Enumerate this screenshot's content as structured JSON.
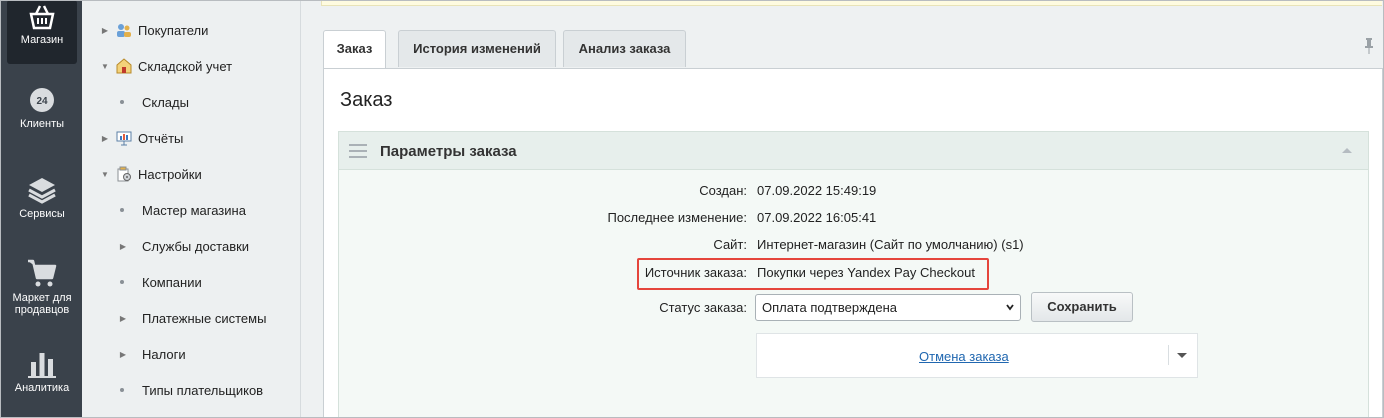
{
  "rail": {
    "items": [
      {
        "label": "Магазин",
        "icon": "basket-icon"
      },
      {
        "label": "Клиенты",
        "icon": "clock-24-icon"
      },
      {
        "label": "Сервисы",
        "icon": "layers-icon"
      },
      {
        "label": "Маркет для продавцов",
        "icon": "cart-icon"
      },
      {
        "label": "Аналитика",
        "icon": "bar-chart-icon"
      }
    ]
  },
  "tree": {
    "items": [
      {
        "label": "Покупатели",
        "expand": "collapsed",
        "icon": "users-icon"
      },
      {
        "label": "Складской учет",
        "expand": "expanded",
        "icon": "warehouse-icon"
      },
      {
        "label": "Склады",
        "expand": "leaf"
      },
      {
        "label": "Отчёты",
        "expand": "collapsed",
        "icon": "report-icon"
      },
      {
        "label": "Настройки",
        "expand": "expanded",
        "icon": "settings-icon"
      },
      {
        "label": "Мастер магазина",
        "expand": "leaf"
      },
      {
        "label": "Службы доставки",
        "expand": "collapsed"
      },
      {
        "label": "Компании",
        "expand": "leaf"
      },
      {
        "label": "Платежные системы",
        "expand": "collapsed"
      },
      {
        "label": "Налоги",
        "expand": "collapsed"
      },
      {
        "label": "Типы плательщиков",
        "expand": "leaf"
      }
    ]
  },
  "tabs": [
    {
      "label": "Заказ",
      "active": true
    },
    {
      "label": "История изменений",
      "active": false
    },
    {
      "label": "Анализ заказа",
      "active": false
    }
  ],
  "page": {
    "title": "Заказ"
  },
  "section": {
    "title": "Параметры заказа",
    "fields": {
      "created": {
        "label": "Создан:",
        "value": "07.09.2022 15:49:19"
      },
      "modified": {
        "label": "Последнее изменение:",
        "value": "07.09.2022 16:05:41"
      },
      "site": {
        "label": "Сайт:",
        "value": "Интернет-магазин (Сайт по умолчанию) (s1)"
      },
      "source": {
        "label": "Источник заказа:",
        "value": "Покупки через Yandex Pay Checkout"
      },
      "status": {
        "label": "Статус заказа:",
        "value": "Оплата подтверждена"
      }
    },
    "save_label": "Сохранить",
    "cancel_label": "Отмена заказа"
  },
  "colors": {
    "highlight": "#e5453c",
    "link": "#2067b0",
    "sidebar": "#3a424b"
  }
}
